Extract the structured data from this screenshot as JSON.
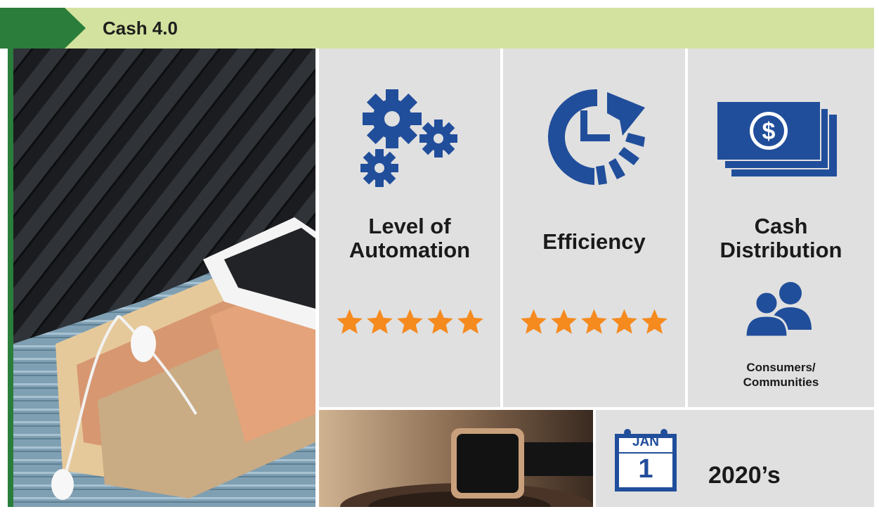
{
  "header": {
    "title": "Cash 4.0"
  },
  "colors": {
    "header_band": "#d3e29e",
    "accent_green": "#2a7d3b",
    "icon_blue": "#214e9b",
    "star_orange": "#f58a1f",
    "panel_gray": "#e0e0e0"
  },
  "panels": [
    {
      "icon": "gears-icon",
      "label_lines": [
        "Level of",
        "Automation"
      ],
      "rating": 5
    },
    {
      "icon": "clock-refresh-icon",
      "label": "Efficiency",
      "rating": 5
    },
    {
      "icon": "money-stack-icon",
      "label_lines": [
        "Cash",
        "Distribution"
      ],
      "sub_icon": "people-icon",
      "sub_label_lines": [
        "Consumers/",
        "Communities"
      ]
    }
  ],
  "calendar": {
    "icon": "calendar-icon",
    "month": "JAN",
    "day": "1"
  },
  "era": "2020’s",
  "images": [
    "wallet-photo",
    "smartwatch-photo"
  ]
}
